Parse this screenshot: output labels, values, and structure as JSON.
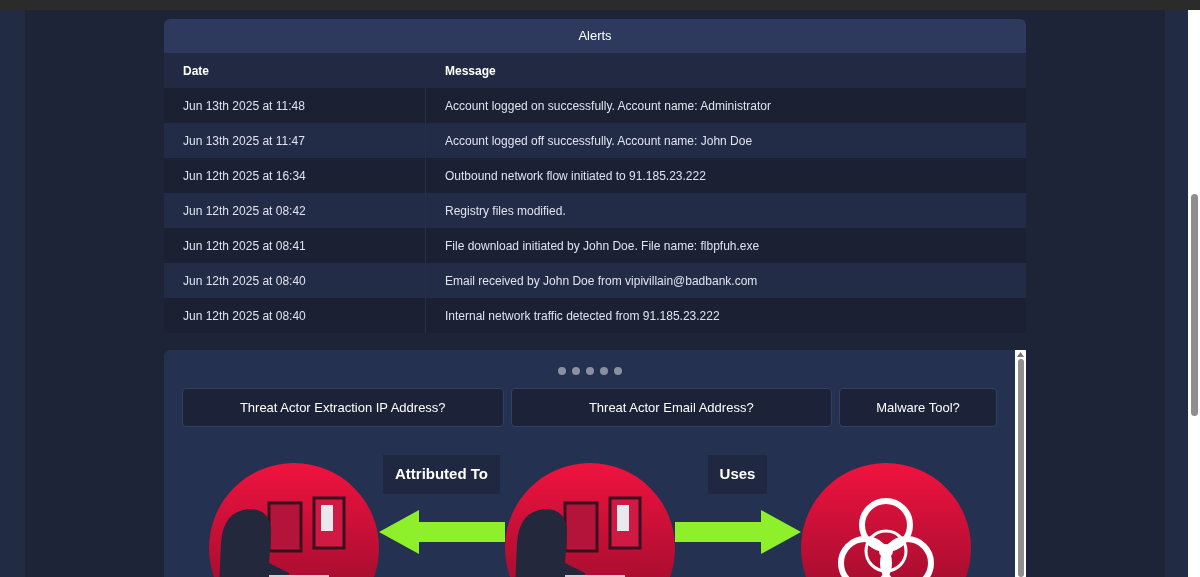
{
  "alerts": {
    "title": "Alerts",
    "columns": [
      "Date",
      "Message"
    ],
    "rows": [
      {
        "date": "Jun 13th 2025 at 11:48",
        "message": "Account logged on successfully. Account name: Administrator"
      },
      {
        "date": "Jun 13th 2025 at 11:47",
        "message": "Account logged off successfully. Account name: John Doe"
      },
      {
        "date": "Jun 12th 2025 at 16:34",
        "message": "Outbound network flow initiated to 91.185.23.222"
      },
      {
        "date": "Jun 12th 2025 at 08:42",
        "message": "Registry files modified."
      },
      {
        "date": "Jun 12th 2025 at 08:41",
        "message": "File download initiated by John Doe. File name: flbpfuh.exe"
      },
      {
        "date": "Jun 12th 2025 at 08:40",
        "message": "Email received by John Doe from vipivillain@badbank.com"
      },
      {
        "date": "Jun 12th 2025 at 08:40",
        "message": "Internal network traffic detected from 91.185.23.222"
      }
    ]
  },
  "questions": [
    "Threat Actor Extraction IP Address?",
    "Threat Actor Email Address?",
    "Malware Tool?"
  ],
  "diagram": {
    "nodes": [
      {
        "kind": "hacker"
      },
      {
        "kind": "hacker"
      },
      {
        "kind": "biohazard"
      }
    ],
    "links": [
      {
        "label": "Attributed To",
        "kind": "left"
      },
      {
        "label": "Uses",
        "kind": "right"
      }
    ]
  }
}
